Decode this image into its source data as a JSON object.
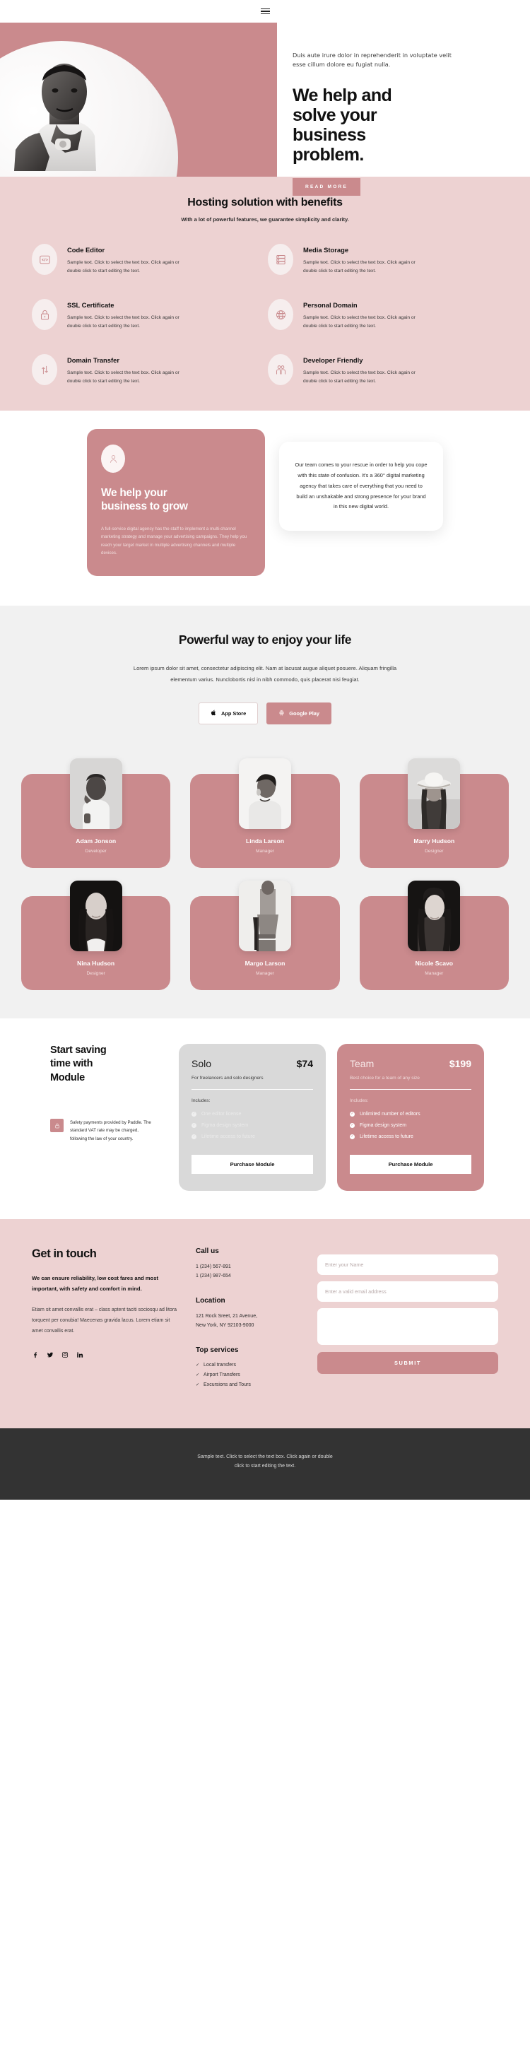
{
  "nav": {
    "menu_label": "menu-toggle"
  },
  "hero": {
    "subtext": "Duis aute irure dolor in reprehenderit in voluptate velit esse cillum dolore eu fugiat nulla.",
    "title_line1": "We help and",
    "title_line2": "solve your",
    "title_line3": "business",
    "title_line4": "problem.",
    "cta": "READ MORE"
  },
  "benefits": {
    "title": "Hosting solution with benefits",
    "subtitle": "With a lot of powerful features, we guarantee simplicity and clarity.",
    "body": "Sample text. Click to select the text box. Click again or double click to start editing the text.",
    "items": [
      {
        "icon": "code-editor-icon",
        "title": "Code Editor"
      },
      {
        "icon": "media-storage-icon",
        "title": "Media Storage"
      },
      {
        "icon": "ssl-lock-icon",
        "title": "SSL Certificate"
      },
      {
        "icon": "globe-www-icon",
        "title": "Personal Domain"
      },
      {
        "icon": "transfer-arrows-icon",
        "title": "Domain Transfer"
      },
      {
        "icon": "people-icon",
        "title": "Developer Friendly"
      }
    ]
  },
  "grow": {
    "icon": "user-avatar-icon",
    "heading_line1": "We help your",
    "heading_line2": "business to grow",
    "paragraph": "A full-service digital agency has the staff to implement a multi-channel marketing strategy and manage your advertising campaigns. They help you reach your target market in multiple advertising channels and multiple devices.",
    "quote": "Our team comes to your rescue in order to help you cope with this state of confusion. It's a 360° digital marketing agency that takes care of everything that you need to build an unshakable and strong presence for your brand in this new digital world."
  },
  "powerful": {
    "title": "Powerful way to enjoy your life",
    "paragraph": "Lorem ipsum dolor sit amet, consectetur adipiscing elit. Nam at lacusat augue aliquet posuere. Aliquam fringilla elementum varius. Nunclobortis nisl in nibh commodo, quis placerat nisi feugiat.",
    "buttons": [
      {
        "icon": "apple-icon",
        "label": "App Store"
      },
      {
        "icon": "android-icon",
        "label": "Google Play"
      }
    ]
  },
  "team": {
    "members": [
      {
        "name": "Adam Jonson",
        "role": "Developer",
        "photo": "man-hand-on-head-photo"
      },
      {
        "name": "Linda Larson",
        "role": "Manager",
        "photo": "woman-smiling-photo"
      },
      {
        "name": "Marry Hudson",
        "role": "Designer",
        "photo": "woman-with-hat-photo"
      },
      {
        "name": "Nina Hudson",
        "role": "Designer",
        "photo": "woman-long-hair-photo"
      },
      {
        "name": "Margo Larson",
        "role": "Manager",
        "photo": "person-sitting-chair-photo"
      },
      {
        "name": "Nicole Scavo",
        "role": "Manager",
        "photo": "woman-portrait-photo"
      }
    ]
  },
  "pricing": {
    "heading_line1": "Start saving",
    "heading_line2": "time with",
    "heading_line3": "Module",
    "note_icon": "padlock-icon",
    "note": "Safety payments provided by Paddle. The standard VAT rate may be charged, following the law of your country.",
    "plans": [
      {
        "name": "Solo",
        "price": "$74",
        "subtitle": "For freelancers and solo designers",
        "includes_label": "Includes:",
        "features": [
          "One editor license",
          "Figma design system",
          "Lifetime access to future"
        ],
        "cta": "Purchase Module"
      },
      {
        "name": "Team",
        "price": "$199",
        "subtitle": "Best choice for a team of any size",
        "includes_label": "Includes:",
        "features": [
          "Unlimited number of editors",
          "Figma design system",
          "Lifetime access to future"
        ],
        "cta": "Purchase Module"
      }
    ]
  },
  "contact": {
    "heading": "Get in touch",
    "strong": "We can ensure reliability, low cost fares and most important, with safety and comfort in mind.",
    "paragraph": "Etiam sit amet convallis erat – class aptent taciti sociosqu ad litora torquent per conubia! Maecenas gravida lacus. Lorem etiam sit amet convallis erat.",
    "socials": [
      "facebook-icon",
      "twitter-icon",
      "instagram-icon",
      "linkedin-icon"
    ],
    "call_heading": "Call us",
    "phone1": "1 (234) 567-891",
    "phone2": "1 (234) 987-654",
    "location_heading": "Location",
    "address_line1": "121 Rock Sreet, 21 Avenue,",
    "address_line2": "New York, NY 92103-9000",
    "services_heading": "Top services",
    "services": [
      "Local transfers",
      "Airport Transfers",
      "Excursions and Tours"
    ],
    "form": {
      "name_placeholder": "Enter your Name",
      "email_placeholder": "Enter a valid email address",
      "message_placeholder": "",
      "submit": "SUBMIT"
    }
  },
  "footer": {
    "text_line1": "Sample text. Click to select the text box. Click again or double",
    "text_line2": "click to start editing the text."
  },
  "colors": {
    "accent": "#ca8a8d",
    "accent_light": "#edd2d2",
    "grey_bg": "#f1f1f1",
    "footer_bg": "#333333"
  }
}
